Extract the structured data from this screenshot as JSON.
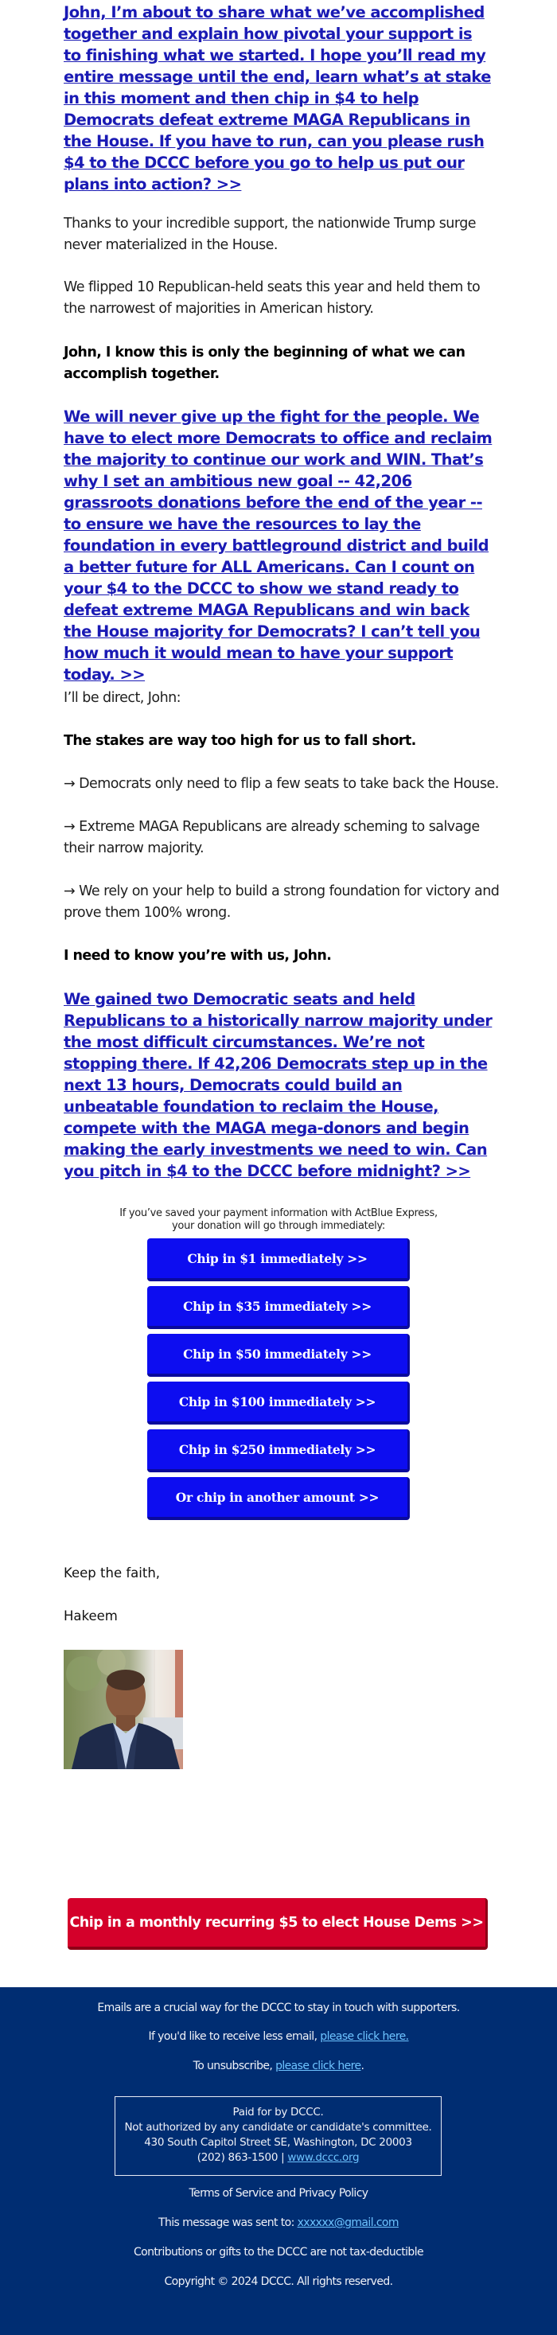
{
  "paragraphs": {
    "p1_link": "John, I’m about to share what we’ve accomplished together and explain how pivotal your support is to finishing what we started. I hope you’ll read my entire message until the end, learn what’s at stake in this moment and then chip in $4 to help Democrats defeat extreme MAGA Republicans in the House. If you have to run, can you please rush $4 to the DCCC before you go to help us put our plans into action? >>",
    "p2": "Thanks to your incredible support, the nationwide Trump surge never materialized in the House.",
    "p3": "We flipped 10 Republican-held seats this year and held them to the narrowest of majorities in American history.",
    "p4_bold": "John, I know this is only the beginning of what we can accomplish together.",
    "p5_link": "We will never give up the fight for the people. We have to elect more Democrats to office and reclaim the majority to continue our work and WIN. That’s why I set an ambitious new goal -- 42,206 grassroots donations before the end of the year -- to ensure we have the resources to lay the foundation in every battleground district and build a better future for ALL Americans. Can I count on your $4 to the DCCC to show we stand ready to defeat extreme MAGA Republicans and win back the House majority for Democrats? I can’t tell you how much it would mean to have your support today. >>",
    "p6": "I’ll be direct, John:",
    "p7_bold": "The stakes are way too high for us to fall short.",
    "bullets": [
      "→ Democrats only need to flip a few seats to take back the House.",
      "→ Extreme MAGA Republicans are already scheming to salvage their narrow majority.",
      "→ We rely on your help to build a strong foundation for victory and prove them 100% wrong."
    ],
    "p8_bold": "I need to know you’re with us, John.",
    "p9_link": "We gained two Democratic seats and held Republicans to a historically narrow majority under the most difficult circumstances. We’re not stopping there. If 42,206 Democrats step up in the next 13 hours, Democrats could build an unbeatable foundation to reclaim the House, compete with the MAGA mega-donors and begin making the early investments we need to win. Can you pitch in $4 to the DCCC before midnight? >>"
  },
  "donation": {
    "prompt_line1": "If you’ve saved your payment information with ActBlue Express,",
    "prompt_line2": "your donation will go through immediately:",
    "buttons": [
      "Chip in $1 immediately >>",
      "Chip in $35 immediately >>",
      "Chip in $50 immediately >>",
      "Chip in $100 immediately >>",
      "Chip in $250 immediately >>",
      "Or chip in another amount >>"
    ]
  },
  "signoff": {
    "closing": "Keep the faith,",
    "name": "Hakeem",
    "photo_alt": "portrait-photo"
  },
  "recurring_button": "Chip in a monthly recurring $5 to elect House Dems >>",
  "footer": {
    "line1": "Emails are a crucial way for the DCCC to stay in touch with supporters.",
    "less_email_prefix": "If you'd like to receive less email, ",
    "less_email_link": "please click here.",
    "unsub_prefix": "To unsubscribe, ",
    "unsub_link": "please click here",
    "unsub_suffix": ".",
    "disclaimer": {
      "line1": "Paid for by DCCC.",
      "line2": "Not authorized by any candidate or candidate's committee.",
      "line3": "430 South Capitol Street SE, Washington, DC 20003",
      "phone": "(202) 863-1500 | ",
      "website": "www.dccc.org"
    },
    "terms": "Terms of Service and Privacy Policy",
    "sent_to_prefix": "This message was sent to: ",
    "sent_to_email": "xxxxxx@gmail.com",
    "tax": "Contributions or gifts to the DCCC are not tax-deductible",
    "copyright": "Copyright © 2024 DCCC. All rights reserved."
  },
  "colors": {
    "link_blue": "#1a1ab4",
    "button_blue": "#0d0df0",
    "button_red": "#d4002a",
    "footer_bg": "#002d72",
    "footer_link": "#6ec3ff"
  }
}
